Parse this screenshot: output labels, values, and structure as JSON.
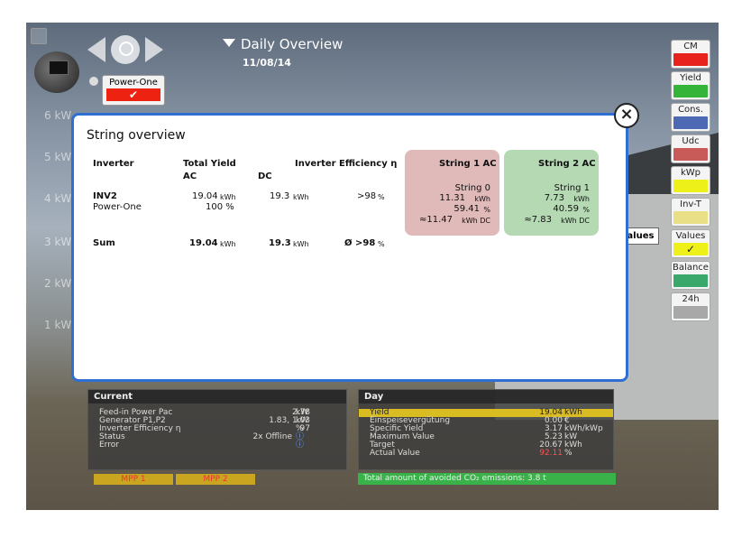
{
  "header": {
    "title": "Daily Overview",
    "date": "11/08/14"
  },
  "device": {
    "label": "Power-One"
  },
  "ghost_axis": [
    "6 kW",
    "5 kW",
    "4 kW",
    "3 kW",
    "2 kW",
    "1 kW"
  ],
  "right_buttons": [
    {
      "label": "CM",
      "color": "#e8231d"
    },
    {
      "label": "Yield",
      "color": "#35b43a"
    },
    {
      "label": "Cons.",
      "color": "#4d69b3"
    },
    {
      "label": "Udc",
      "color": "#c85a58"
    },
    {
      "label": "kWp",
      "color": "#eef019"
    },
    {
      "label": "Inv-T",
      "color": "#e8df86"
    },
    {
      "label": "Values",
      "color": "#eef019",
      "check": "✓"
    },
    {
      "label": "Balance",
      "color": "#3aa86a"
    },
    {
      "label": "24h",
      "color": "#a8a8a8"
    }
  ],
  "tooltip": "Show values",
  "modal": {
    "title": "String overview",
    "headers": {
      "inverter": "Inverter",
      "total_yield": "Total Yield",
      "ac": "AC",
      "dc": "DC",
      "efficiency": "Inverter Efficiency η"
    },
    "inverter": {
      "name": "INV2",
      "brand": "Power-One",
      "ac_value": "19.04",
      "ac_unit": "kWh",
      "share": "100 %",
      "dc_value": "19.3",
      "dc_unit": "kWh",
      "eff_value": ">98",
      "eff_unit": "%"
    },
    "sum": {
      "label": "Sum",
      "ac_value": "19.04",
      "ac_unit": "kWh",
      "dc_value": "19.3",
      "dc_unit": "kWh",
      "eff_value": "Ø >98",
      "eff_unit": "%"
    },
    "strings": [
      {
        "title": "String 1 AC",
        "name": "String 0",
        "ac": "11.31",
        "ac_unit": "kWh",
        "pct": "59.41",
        "pct_unit": "%",
        "dc": "≈11.47",
        "dc_unit": "kWh DC",
        "color": "#e0b9b9"
      },
      {
        "title": "String 2 AC",
        "name": "String 1",
        "ac": "7.73",
        "ac_unit": "kWh",
        "pct": "40.59",
        "pct_unit": "%",
        "dc": "≈7.83",
        "dc_unit": "kWh DC",
        "color": "#b5dab3"
      }
    ]
  },
  "current": {
    "title": "Current",
    "rows": [
      {
        "label": "Feed-in Power Pac",
        "value": "2.78",
        "unit": "kW"
      },
      {
        "label": "Generator P1,P2",
        "value": "1.83, 1.03",
        "unit": "kW"
      },
      {
        "label": "Inverter Efficiency η",
        "value": "97",
        "unit": "%"
      },
      {
        "label": "Status",
        "value": "2x Offline",
        "unit": "ⓘ"
      },
      {
        "label": "Error",
        "value": "",
        "unit": "ⓘ"
      }
    ]
  },
  "day": {
    "title": "Day",
    "rows": [
      {
        "label": "Yield",
        "value": "19.04",
        "unit": "kWh"
      },
      {
        "label": "Einspeisevergütung",
        "value": "0.00",
        "unit": "€"
      },
      {
        "label": "Specific Yield",
        "value": "3.17",
        "unit": "kWh/kWp"
      },
      {
        "label": "Maximum Value",
        "value": "5.23",
        "unit": "kW"
      },
      {
        "label": "Target",
        "value": "20.67",
        "unit": "kWh"
      },
      {
        "label": "Actual Value",
        "value": "92.11",
        "unit": "%"
      }
    ]
  },
  "mpp": [
    "MPP 1",
    "MPP 2"
  ],
  "co2": "Total amount of avoided CO₂   emissions: 3.8 t"
}
